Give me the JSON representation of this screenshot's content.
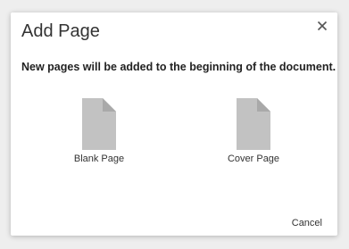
{
  "dialog": {
    "title": "Add Page",
    "message": "New pages will be added to the beginning of the document.",
    "close_icon": "close-icon",
    "options": [
      {
        "label": "Blank Page",
        "icon": "document-icon"
      },
      {
        "label": "Cover Page",
        "icon": "document-icon"
      }
    ],
    "cancel_label": "Cancel"
  },
  "colors": {
    "document_icon": "#c2c2c2",
    "document_fold": "#a9a9a9"
  }
}
